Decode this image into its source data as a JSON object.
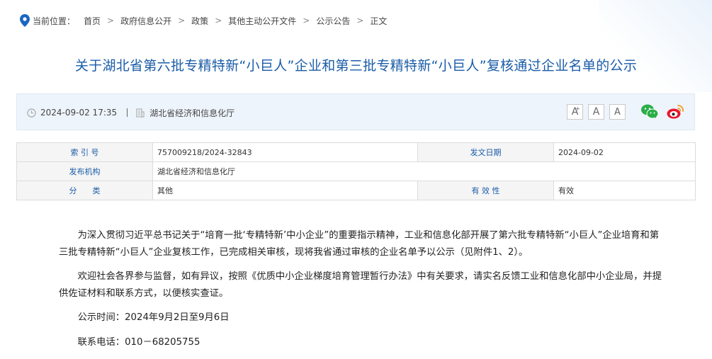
{
  "breadcrumb": {
    "label": "当前位置：",
    "items": [
      "首页",
      "政府信息公开",
      "政策",
      "其他主动公开文件",
      "公示公告",
      "正文"
    ]
  },
  "title": "关于湖北省第六批专精特新“小巨人”企业和第三批专精特新“小巨人”复核通过企业名单的公示",
  "meta": {
    "date": "2024-09-02 17:35",
    "source": "湖北省经济和信息化厅",
    "font_buttons": [
      "A+",
      "A",
      "A-"
    ]
  },
  "info_table": {
    "index_label": "索 引 号",
    "index_value": "757009218/2024-32843",
    "date_label": "发文日期",
    "date_value": "2024-09-02",
    "org_label": "发布机构",
    "org_value": "湖北省经济和信息化厅",
    "category_label": "分　　类",
    "category_value": "其他",
    "validity_label": "有 效 性",
    "validity_value": "有效"
  },
  "body": {
    "p1": "为深入贯彻习近平总书记关于“培育一批‘专精特新’中小企业”的重要指示精神，工业和信息化部开展了第六批专精特新“小巨人”企业培育和第三批专精特新“小巨人”企业复核工作，已完成相关审核，现将我省通过审核的企业名单予以公示（见附件1、2）。",
    "p2": "欢迎社会各界参与监督，如有异议，按照《优质中小企业梯度培育管理暂行办法》中有关要求，请实名反馈工业和信息化部中小企业局，并提供佐证材料和联系方式，以便核实查证。",
    "period": "公示时间：2024年9月2日至9月6日",
    "phone": "联系电话：010－68205755"
  },
  "colors": {
    "title": "#1a5ca8",
    "meta_bg": "#eef4fb",
    "wechat": "#2bae49",
    "weibo": "#e6162d"
  }
}
